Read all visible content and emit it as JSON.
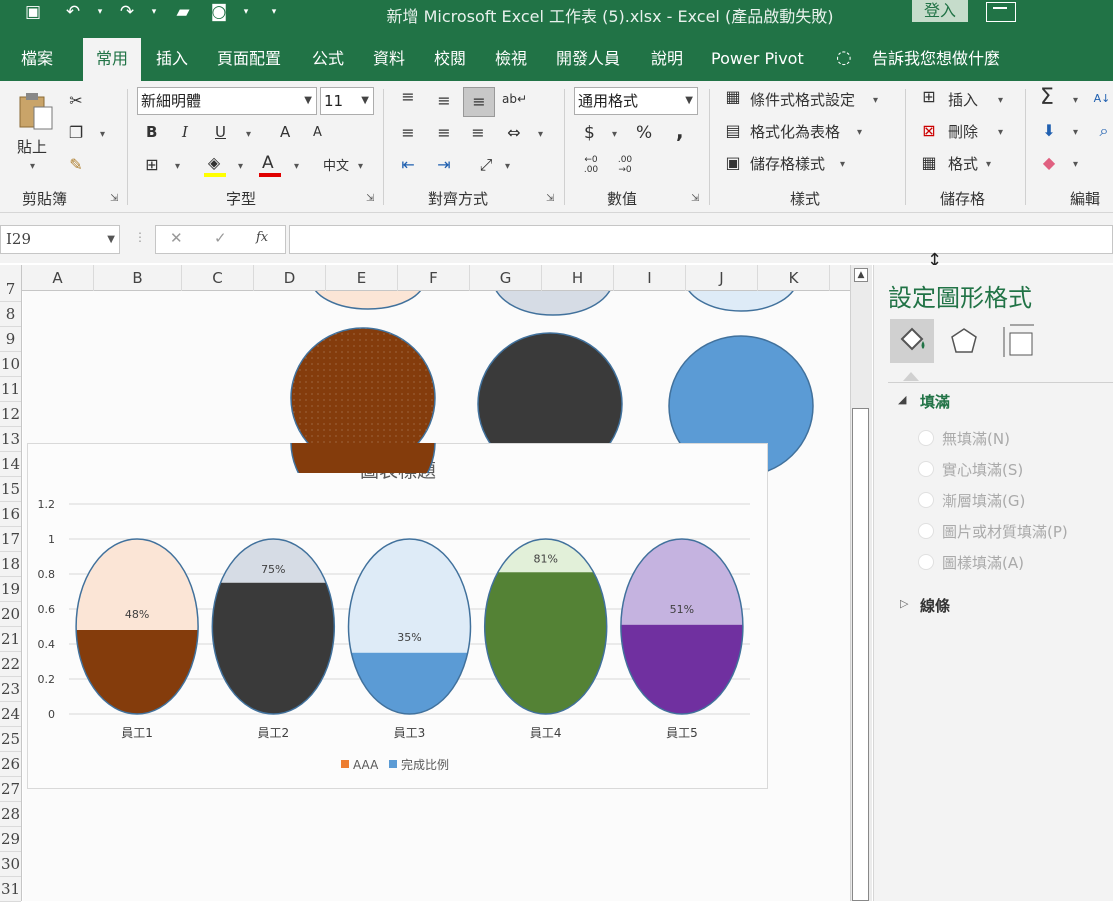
{
  "window": {
    "title": "新增 Microsoft Excel 工作表 (5).xlsx  -  Excel (產品啟動失敗)",
    "login": "登入"
  },
  "tabs": [
    "檔案",
    "常用",
    "插入",
    "頁面配置",
    "公式",
    "資料",
    "校閱",
    "檢視",
    "開發人員",
    "說明",
    "Power Pivot"
  ],
  "active_tab": "常用",
  "tell_me": "告訴我您想做什麼",
  "ribbon": {
    "clipboard": {
      "paste": "貼上",
      "group": "剪貼簿"
    },
    "font": {
      "name": "新細明體",
      "size": "11",
      "group": "字型",
      "bold": "B",
      "italic": "I",
      "underline": "U",
      "grow": "A",
      "shrink": "A",
      "phonetic": "中文"
    },
    "align": {
      "group": "對齊方式"
    },
    "number": {
      "format": "通用格式",
      "group": "數值",
      "currency": "$",
      "percent": "%",
      "comma": ","
    },
    "styles": {
      "cond": "條件式格式設定",
      "table": "格式化為表格",
      "cell": "儲存格樣式",
      "group": "樣式"
    },
    "cells": {
      "insert": "插入",
      "delete": "刪除",
      "format": "格式",
      "group": "儲存格"
    },
    "editing": {
      "sigma": "Σ",
      "group": "編輯"
    }
  },
  "formula_bar": {
    "name_box": "I29",
    "fx": "fx",
    "cancel": "✕",
    "enter": "✓",
    "formula": ""
  },
  "columns": [
    "A",
    "B",
    "C",
    "D",
    "E",
    "F",
    "G",
    "H",
    "I",
    "J",
    "K"
  ],
  "rows": [
    "7",
    "8",
    "9",
    "10",
    "11",
    "12",
    "13",
    "14",
    "15",
    "16",
    "17",
    "18",
    "19",
    "20",
    "21",
    "22",
    "23",
    "24",
    "25",
    "26",
    "27",
    "28",
    "29",
    "30",
    "31"
  ],
  "pane": {
    "title": "設定圖形格式",
    "fill_section": "填滿",
    "fill_options": [
      "無填滿(N)",
      "實心填滿(S)",
      "漸層填滿(G)",
      "圖片或材質填滿(P)",
      "圖樣填滿(A)"
    ],
    "line_section": "線條"
  },
  "colors": {
    "accent": "#217346",
    "brown": "#843c0c",
    "dark": "#3a3a3a",
    "blue": "#5b9bd5",
    "green": "#548235",
    "purple": "#7030a0"
  },
  "chart_data": {
    "type": "bar",
    "title": "圖表標題",
    "categories": [
      "員工1",
      "員工2",
      "員工3",
      "員工4",
      "員工5"
    ],
    "series": [
      {
        "name": "AAA",
        "values": [
          1,
          1,
          1,
          1,
          1
        ]
      },
      {
        "name": "完成比例",
        "values": [
          0.48,
          0.75,
          0.35,
          0.81,
          0.51
        ]
      }
    ],
    "data_labels": [
      "48%",
      "75%",
      "35%",
      "81%",
      "51%"
    ],
    "y_ticks": [
      "1.2",
      "1",
      "0.8",
      "0.6",
      "0.4",
      "0.2",
      "0"
    ],
    "ylim": [
      0,
      1.2
    ],
    "grid": true,
    "legend": "bottom",
    "fill_colors": [
      "#843c0c",
      "#3a3a3a",
      "#5b9bd5",
      "#548235",
      "#7030a0"
    ],
    "top_colors": [
      "#fbe5d6",
      "#d6dce5",
      "#deebf7",
      "#e2f0d9",
      "#c5b3e0"
    ],
    "legend_colors": [
      "#ed7d31",
      "#5b9bd5"
    ]
  }
}
